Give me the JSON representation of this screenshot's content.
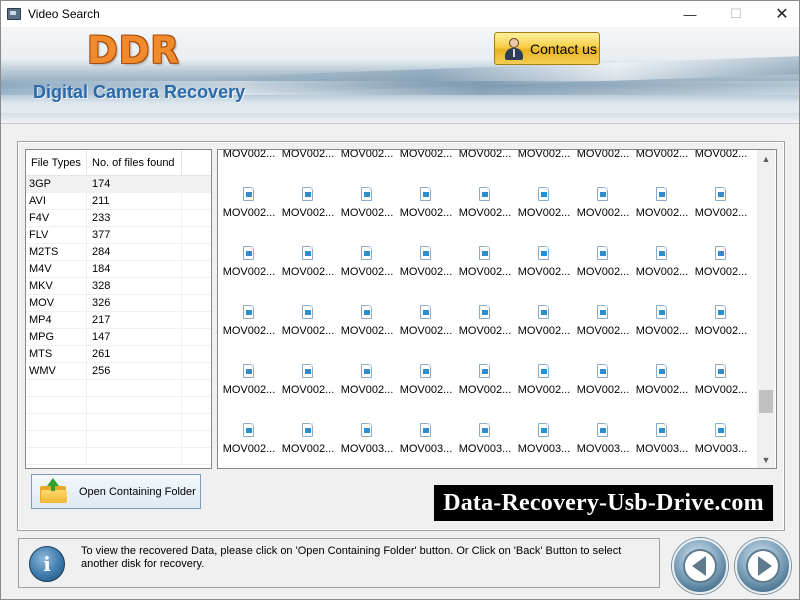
{
  "window": {
    "title": "Video Search",
    "controls": {
      "minimize": "—",
      "maximize": "☐",
      "close": "✕"
    }
  },
  "header": {
    "logo": "DDR",
    "subtitle": "Digital Camera Recovery",
    "contact_label": "Contact us"
  },
  "file_types": {
    "columns": [
      "File Types",
      "No. of files found"
    ],
    "rows": [
      [
        "3GP",
        "174"
      ],
      [
        "AVI",
        "211"
      ],
      [
        "F4V",
        "233"
      ],
      [
        "FLV",
        "377"
      ],
      [
        "M2TS",
        "284"
      ],
      [
        "M4V",
        "184"
      ],
      [
        "MKV",
        "328"
      ],
      [
        "MOV",
        "326"
      ],
      [
        "MP4",
        "217"
      ],
      [
        "MPG",
        "147"
      ],
      [
        "MTS",
        "261"
      ],
      [
        "WMV",
        "256"
      ]
    ],
    "selected_row": 0
  },
  "file_grid": {
    "rows": [
      [
        "MOV002...",
        "MOV002...",
        "MOV002...",
        "MOV002...",
        "MOV002...",
        "MOV002...",
        "MOV002...",
        "MOV002...",
        "MOV002..."
      ],
      [
        "MOV002...",
        "MOV002...",
        "MOV002...",
        "MOV002...",
        "MOV002...",
        "MOV002...",
        "MOV002...",
        "MOV002...",
        "MOV002..."
      ],
      [
        "MOV002...",
        "MOV002...",
        "MOV002...",
        "MOV002...",
        "MOV002...",
        "MOV002...",
        "MOV002...",
        "MOV002...",
        "MOV002..."
      ],
      [
        "MOV002...",
        "MOV002...",
        "MOV002...",
        "MOV002...",
        "MOV002...",
        "MOV002...",
        "MOV002...",
        "MOV002...",
        "MOV002..."
      ],
      [
        "MOV002...",
        "MOV002...",
        "MOV002...",
        "MOV002...",
        "MOV002...",
        "MOV002...",
        "MOV002...",
        "MOV002...",
        "MOV002..."
      ],
      [
        "MOV002...",
        "MOV002...",
        "MOV003...",
        "MOV003...",
        "MOV003...",
        "MOV003...",
        "MOV003...",
        "MOV003...",
        "MOV003..."
      ]
    ],
    "first_row_icons_visible": false,
    "icon": "video-file-icon"
  },
  "actions": {
    "open_folder_label": "Open Containing Folder"
  },
  "website_badge": "Data-Recovery-Usb-Drive.com",
  "info": {
    "icon": "info-icon",
    "text": "To view the recovered Data, please click on 'Open Containing Folder' button. Or Click on 'Back' Button to select another disk for recovery."
  },
  "nav": {
    "back_icon": "back-arrow-icon",
    "next_icon": "next-arrow-icon"
  },
  "colors": {
    "logo": "#f08a2c",
    "subtitle": "#2a6aaa",
    "contact_button": "#f6cf45",
    "badge_bg": "#000000",
    "badge_text": "#ffffff"
  }
}
